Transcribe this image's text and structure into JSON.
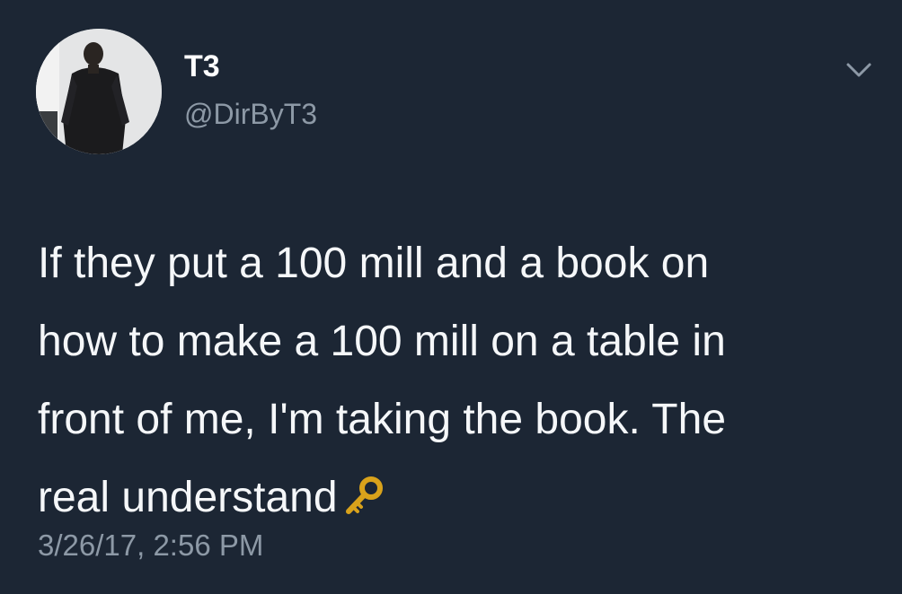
{
  "tweet": {
    "author": {
      "display_name": "T3",
      "handle": "@DirByT3"
    },
    "text_lines": [
      "If they put a 100 mill and a book on",
      "how to make a 100 mill on a table in",
      "front of me, I'm taking the book. The",
      "real understand"
    ],
    "emoji": "key-icon",
    "timestamp": "3/26/17, 2:56 PM",
    "menu_icon": "chevron-down-icon"
  },
  "colors": {
    "background": "#1c2634",
    "text": "#f5f7f9",
    "secondary_text": "#8d99a6",
    "key_gold": "#d9a21b"
  }
}
